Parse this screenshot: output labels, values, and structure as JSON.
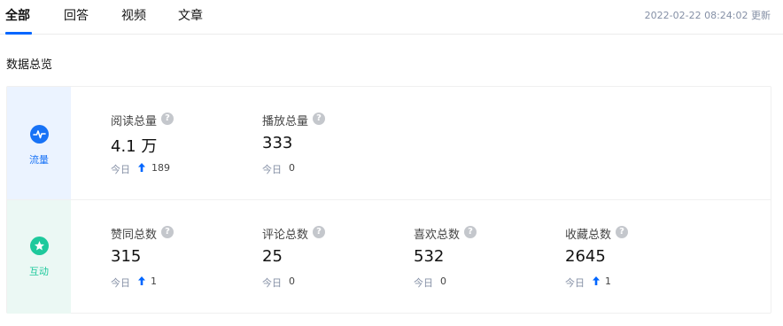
{
  "tabs": [
    {
      "label": "全部",
      "active": true
    },
    {
      "label": "回答",
      "active": false
    },
    {
      "label": "视频",
      "active": false
    },
    {
      "label": "文章",
      "active": false
    }
  ],
  "updated": "2022-02-22 08:24:02 更新",
  "section_title": "数据总览",
  "help_glyph": "?",
  "today_label": "今日",
  "colors": {
    "accent": "#0066ff",
    "flow": "#1772f6",
    "interaction": "#1ec99c"
  },
  "categories": [
    {
      "label": "流量",
      "icon": "activity-icon",
      "stats": [
        {
          "label": "阅读总量",
          "value": "4.1 万",
          "today": "189",
          "up": true
        },
        {
          "label": "播放总量",
          "value": "333",
          "today": "0",
          "up": false
        }
      ]
    },
    {
      "label": "互动",
      "icon": "star-icon",
      "stats": [
        {
          "label": "赞同总数",
          "value": "315",
          "today": "1",
          "up": true
        },
        {
          "label": "评论总数",
          "value": "25",
          "today": "0",
          "up": false
        },
        {
          "label": "喜欢总数",
          "value": "532",
          "today": "0",
          "up": false
        },
        {
          "label": "收藏总数",
          "value": "2645",
          "today": "1",
          "up": true
        }
      ]
    }
  ]
}
